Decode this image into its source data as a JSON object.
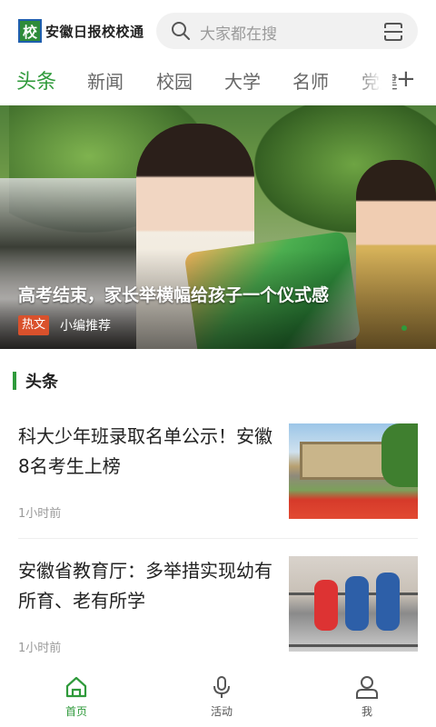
{
  "header": {
    "logo_mark": "校",
    "app_name": "安徽日报校校通",
    "search_placeholder": "大家都在搜"
  },
  "tabs": [
    {
      "label": "头条",
      "active": true
    },
    {
      "label": "新闻",
      "active": false
    },
    {
      "label": "校园",
      "active": false
    },
    {
      "label": "大学",
      "active": false
    },
    {
      "label": "名师",
      "active": false
    },
    {
      "label": "党建",
      "active": false
    }
  ],
  "add_tab_label": "+",
  "banner": {
    "title": "高考结束，家长举横幅给孩子一个仪式感",
    "badge": "热文",
    "source": "小编推荐"
  },
  "section": {
    "title": "头条"
  },
  "news": [
    {
      "title": "科大少年班录取名单公示！安徽8名考生上榜",
      "time": "1小时前",
      "thumb_icon": "campus-gate-photo"
    },
    {
      "title": "安徽省教育厅：多举措实现幼有所育、老有所学",
      "time": "1小时前",
      "thumb_icon": "children-playground-photo"
    }
  ],
  "bottom_nav": [
    {
      "label": "首页",
      "icon": "home-icon",
      "active": true
    },
    {
      "label": "活动",
      "icon": "microphone-icon",
      "active": false
    },
    {
      "label": "我",
      "icon": "user-icon",
      "active": false
    }
  ],
  "colors": {
    "accent": "#2f9a3b",
    "badge": "#d9512c"
  }
}
